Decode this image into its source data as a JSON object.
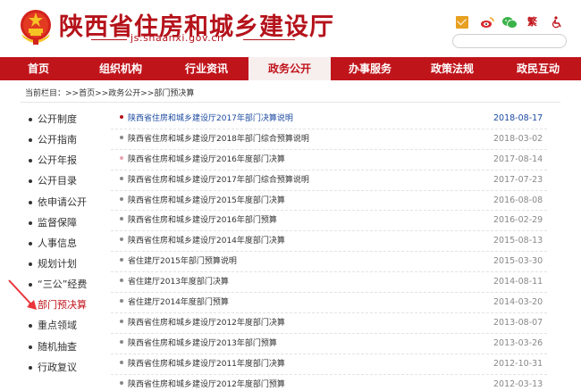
{
  "header": {
    "title": "陕西省住房和城乡建设厅",
    "domain": "js.shaanxi.gov.cn",
    "traditional_label": "繁",
    "icons": [
      "email-icon",
      "weibo-icon",
      "wechat-icon",
      "accessibility-icon"
    ],
    "search_placeholder": ""
  },
  "nav": {
    "items": [
      {
        "label": "首页",
        "active": false
      },
      {
        "label": "组织机构",
        "active": false
      },
      {
        "label": "行业资讯",
        "active": false
      },
      {
        "label": "政务公开",
        "active": true
      },
      {
        "label": "办事服务",
        "active": false
      },
      {
        "label": "政策法规",
        "active": false
      },
      {
        "label": "政民互动",
        "active": false
      }
    ]
  },
  "breadcrumb": {
    "prefix": "当前栏目：",
    "sep": ">>",
    "items": [
      "首页",
      "政务公开",
      "部门预决算"
    ]
  },
  "sidebar": {
    "items": [
      {
        "label": "公开制度",
        "active": false
      },
      {
        "label": "公开指南",
        "active": false
      },
      {
        "label": "公开年报",
        "active": false
      },
      {
        "label": "公开目录",
        "active": false
      },
      {
        "label": "依申请公开",
        "active": false
      },
      {
        "label": "监督保障",
        "active": false
      },
      {
        "label": "人事信息",
        "active": false
      },
      {
        "label": "规划计划",
        "active": false
      },
      {
        "label": "“三公”经费",
        "active": false
      },
      {
        "label": "部门预决算",
        "active": true
      },
      {
        "label": "重点领域",
        "active": false
      },
      {
        "label": "随机抽查",
        "active": false
      },
      {
        "label": "行政复议",
        "active": false
      }
    ]
  },
  "list": {
    "rows": [
      {
        "title": "陕西省住房和城乡建设厅2017年部门决算说明",
        "date": "2018-08-17",
        "highlight": true,
        "dot_color": "#b5121b"
      },
      {
        "title": "陕西省住房和城乡建设厅2018年部门综合预算说明",
        "date": "2018-03-02",
        "highlight": false,
        "dot_color": "#888888"
      },
      {
        "title": "陕西省住房和城乡建设厅2016年度部门决算",
        "date": "2017-08-14",
        "highlight": false,
        "dot_color": "#e8a3b3"
      },
      {
        "title": "陕西省住房和城乡建设厅2017年部门综合预算说明",
        "date": "2017-07-23",
        "highlight": false,
        "dot_color": "#888888"
      },
      {
        "title": "陕西省住房和城乡建设厅2015年度部门决算",
        "date": "2016-08-08",
        "highlight": false,
        "dot_color": "#888888"
      },
      {
        "title": "陕西省住房和城乡建设厅2016年部门预算",
        "date": "2016-02-29",
        "highlight": false,
        "dot_color": "#888888"
      },
      {
        "title": "陕西省住房和城乡建设厅2014年度部门决算",
        "date": "2015-08-13",
        "highlight": false,
        "dot_color": "#888888"
      },
      {
        "title": "省住建厅2015年部门预算说明",
        "date": "2015-03-30",
        "highlight": false,
        "dot_color": "#888888"
      },
      {
        "title": "省住建厅2013年度部门决算",
        "date": "2014-08-11",
        "highlight": false,
        "dot_color": "#888888"
      },
      {
        "title": "省住建厅2014年度部门预算",
        "date": "2014-03-20",
        "highlight": false,
        "dot_color": "#888888"
      },
      {
        "title": "陕西省住房和城乡建设厅2012年度部门决算",
        "date": "2013-08-07",
        "highlight": false,
        "dot_color": "#888888"
      },
      {
        "title": "陕西省住房和城乡建设厅2013年部门预算",
        "date": "2013-03-26",
        "highlight": false,
        "dot_color": "#888888"
      },
      {
        "title": "陕西省住房和城乡建设厅2011年度部门决算",
        "date": "2012-10-31",
        "highlight": false,
        "dot_color": "#888888"
      },
      {
        "title": "陕西省住房和城乡建设厅2012年度部门预算",
        "date": "2012-03-13",
        "highlight": false,
        "dot_color": "#888888"
      }
    ]
  },
  "colors": {
    "brand_red": "#c0141b",
    "link_blue": "#1b4aa1",
    "annotation_arrow": "#e8343a"
  }
}
